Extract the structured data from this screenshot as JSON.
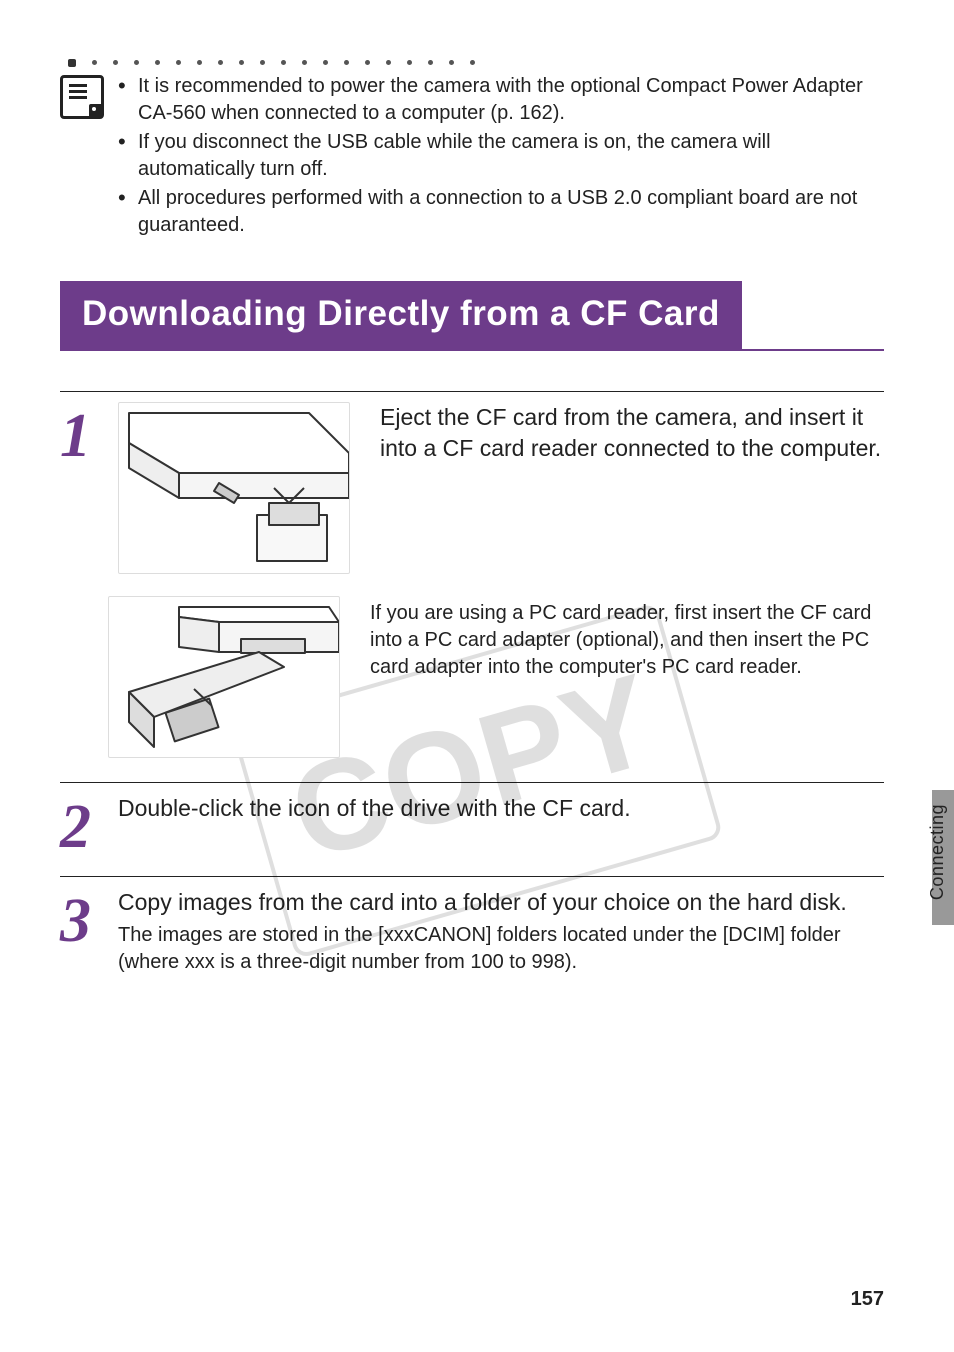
{
  "notes": {
    "items": [
      "It is recommended to power the camera with the optional Compact Power Adapter CA-560 when connected to a computer (p. 162).",
      "If you disconnect the USB cable while the camera is on, the camera will automatically turn off.",
      "All procedures performed with a connection to a USB 2.0 compliant board are not guaranteed."
    ]
  },
  "section_heading": "Downloading Directly from a CF Card",
  "steps": {
    "s1": {
      "num": "1",
      "main": "Eject the CF card from the camera, and insert it into a CF card reader connected to the computer.",
      "sub": "If you are using a PC card reader, first insert the CF card into a PC card adapter (optional), and then insert the PC card adapter into the computer's PC card reader."
    },
    "s2": {
      "num": "2",
      "main": "Double-click the icon of the drive with the CF card."
    },
    "s3": {
      "num": "3",
      "main": "Copy images from the card into a folder of your choice on the hard disk.",
      "sub": "The images are stored in the [xxxCANON] folders located under the [DCIM] folder (where xxx is a three-digit number from 100 to 998)."
    }
  },
  "side_tab_label": "Connecting",
  "page_number": "157"
}
